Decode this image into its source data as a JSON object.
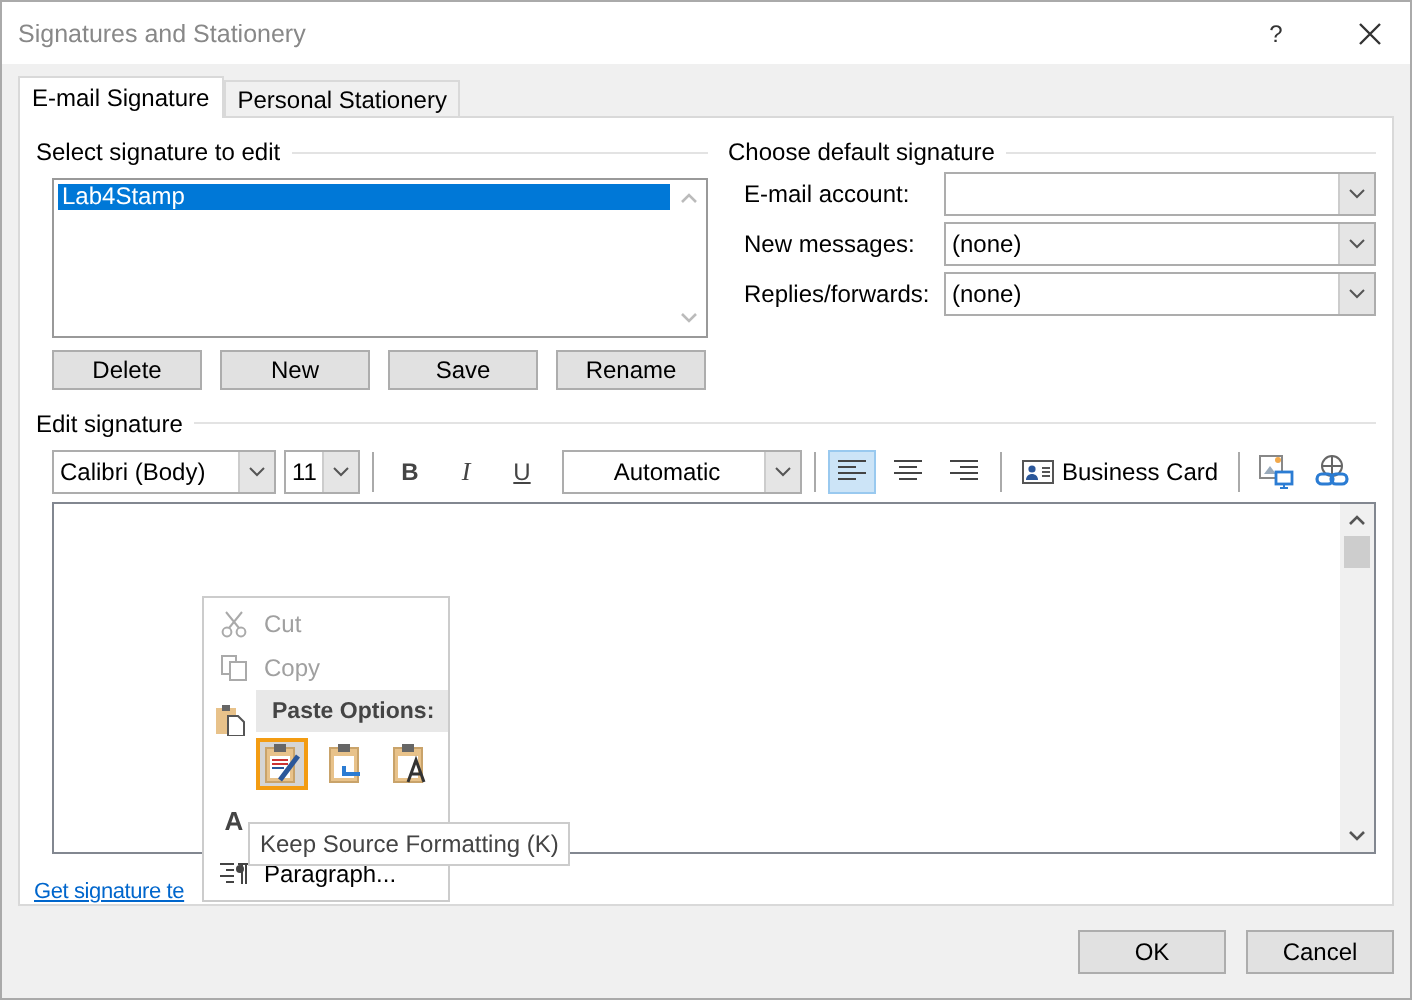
{
  "window": {
    "title": "Signatures and Stationery",
    "help": "?"
  },
  "tabs": [
    {
      "label": "E-mail Signature",
      "selected": true
    },
    {
      "label": "Personal Stationery",
      "selected": false
    }
  ],
  "select_signature": {
    "heading": "Select signature to edit",
    "items": [
      {
        "label": "Lab4Stamp",
        "selected": true
      }
    ],
    "buttons": [
      "Delete",
      "New",
      "Save",
      "Rename"
    ]
  },
  "default_signature": {
    "heading": "Choose default signature",
    "fields": [
      {
        "label": "E-mail account:"
      },
      {
        "label": "New messages:",
        "value": "(none)"
      },
      {
        "label": "Replies/forwards:",
        "value": "(none)"
      }
    ]
  },
  "edit_signature": {
    "heading": "Edit signature",
    "font": "Calibri (Body)",
    "size": "11",
    "bold": "B",
    "italic": "I",
    "underline": "U",
    "font_color": "Automatic",
    "alignments": [
      {
        "kind": "left",
        "selected": true
      },
      {
        "kind": "center",
        "selected": false
      },
      {
        "kind": "right",
        "selected": false
      }
    ],
    "business_card": "Business Card",
    "link": "Get signature te"
  },
  "context_menu": {
    "items": [
      {
        "kind": "cut",
        "label": "Cut",
        "disabled": true
      },
      {
        "kind": "copy",
        "label": "Copy",
        "disabled": true
      },
      {
        "kind": "header",
        "label": "Paste Options:"
      },
      {
        "kind": "paste",
        "options": [
          {
            "kind": "keep",
            "selected": true
          },
          {
            "kind": "merge",
            "selected": false
          },
          {
            "kind": "text",
            "selected": false
          }
        ]
      },
      {
        "kind": "font",
        "icon": "A"
      },
      {
        "kind": "paragraph",
        "label": "Paragraph...",
        "disabled": false
      }
    ]
  },
  "tooltip": "Keep Source Formatting (K)",
  "buttons": [
    "OK",
    "Cancel"
  ]
}
